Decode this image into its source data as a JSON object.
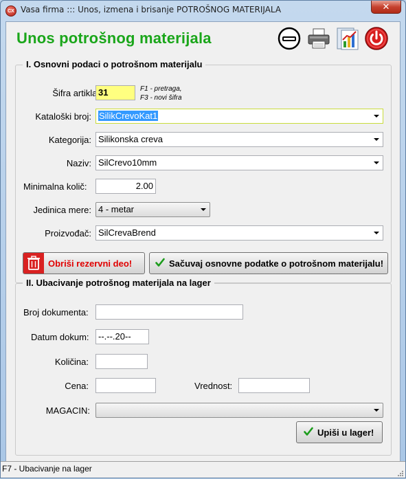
{
  "window": {
    "app_icon_text": "CX",
    "title": "Vasa firma ::: Unos, izmena i brisanje POTROŠNOG MATERIJALA",
    "close_symbol": "✕"
  },
  "header": {
    "title": "Unos potrošnog materijala",
    "toolbar_icons": [
      "minimize-icon",
      "printer-icon",
      "report-chart-icon",
      "power-icon"
    ],
    "title_color": "#1aa61a"
  },
  "section1": {
    "legend": "I.  Osnovni podaci o potrošnom materijalu",
    "sifra": {
      "label": "Šifra artikla:",
      "value": "31",
      "hint_line1": "F1 - pretraga,",
      "hint_line2": "F3 - novi šifra"
    },
    "kataloski": {
      "label": "Kataloški broj:",
      "value": "SilikCrevoKat1"
    },
    "kategorija": {
      "label": "Kategorija:",
      "value": "Silikonska creva"
    },
    "naziv": {
      "label": "Naziv:",
      "value": "SilCrevo10mm"
    },
    "minimalna": {
      "label": "Minimalna količ:",
      "value": "2.00"
    },
    "jedinica": {
      "label": "Jedinica mere:",
      "value": "4 - metar"
    },
    "proizvodjac": {
      "label": "Proizvođač:",
      "value": "SilCrevaBrend"
    },
    "delete_button": "Obriši rezervni deo!",
    "save_button": "Sačuvaj osnovne podatke o potrošnom materijalu!",
    "delete_color": "#e00000",
    "highlight_color": "#ffff80"
  },
  "section2": {
    "legend": "II.  Ubacivanje potrošnog materijala na lager",
    "broj_dokumenta": {
      "label": "Broj dokumenta:",
      "value": ""
    },
    "datum": {
      "label": "Datum dokum:",
      "value": "--.--.20--"
    },
    "kolicina": {
      "label": "Količina:",
      "value": ""
    },
    "cena": {
      "label": "Cena:",
      "value": ""
    },
    "vrednost": {
      "label": "Vrednost:",
      "value": ""
    },
    "magacin": {
      "label": "MAGACIN:",
      "value": ""
    },
    "lager_button": "Upiši u lager!"
  },
  "statusbar": {
    "text": "F7 - Ubacivanje na lager"
  }
}
